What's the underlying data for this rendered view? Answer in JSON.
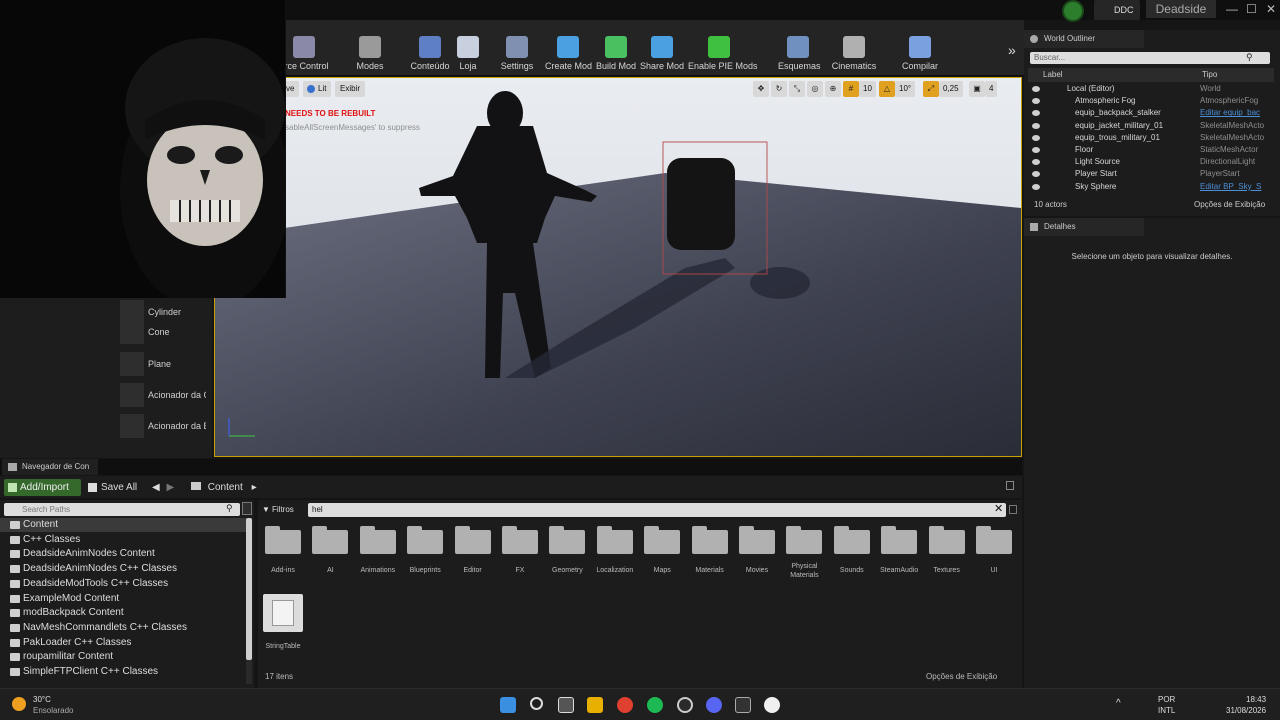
{
  "titlebar": {
    "ddc_label": "DDC",
    "project_tab": "Deadside",
    "minimize": "—",
    "maximize": "☐",
    "close": "✕"
  },
  "toolbar": {
    "buttons": [
      {
        "label": "urce Control",
        "icon": "source-control-icon",
        "color": "#8a8aa8"
      },
      {
        "label": "Modes",
        "icon": "modes-icon",
        "color": "#9a9a9a"
      },
      {
        "label": "Conteúdo",
        "icon": "content-icon",
        "color": "#5f7fc4"
      },
      {
        "label": "Loja",
        "icon": "store-icon",
        "color": "#c8d0e0"
      },
      {
        "label": "Settings",
        "icon": "settings-icon",
        "color": "#8090b0"
      },
      {
        "label": "Create Mod",
        "icon": "create-mod-icon",
        "color": "#4aa0e0"
      },
      {
        "label": "Build Mod",
        "icon": "build-mod-icon",
        "color": "#4ac060"
      },
      {
        "label": "Share Mod",
        "icon": "share-mod-icon",
        "color": "#4aa0e0"
      },
      {
        "label": "Enable PIE Mods",
        "icon": "enable-pie-icon",
        "color": "#40c040"
      },
      {
        "label": "Esquemas",
        "icon": "blueprints-icon",
        "color": "#7090c0"
      },
      {
        "label": "Cinematics",
        "icon": "cinematics-icon",
        "color": "#b0b0b0"
      },
      {
        "label": "Compilar",
        "icon": "compile-icon",
        "color": "#7aa0e0"
      }
    ],
    "overflow": "»"
  },
  "modes_panel": {
    "items": [
      "Cylinder",
      "Cone",
      "Plane",
      "Acionador da C",
      "Acionador da E"
    ]
  },
  "viewport": {
    "view_mode_left": "ve",
    "lit_label": "Lit",
    "show_label": "Exibir",
    "warning": "NEEDS TO BE REBUILT",
    "suppress_text": "sableAllScreenMessages' to suppress",
    "grid_snap": "10",
    "rotation_snap": "10°",
    "scale_snap": "0,25",
    "camera_speed": "4"
  },
  "world_outliner": {
    "tab_label": "World Outliner",
    "search_placeholder": "Buscar...",
    "col_label": "Label",
    "col_type": "Tipo",
    "rows": [
      {
        "name": "Local (Editor)",
        "type": "World",
        "link": false,
        "indent": 0
      },
      {
        "name": "Atmospheric Fog",
        "type": "AtmosphericFog",
        "link": false,
        "indent": 1
      },
      {
        "name": "equip_backpack_stalker",
        "type": "Editar equip_bac",
        "link": true,
        "indent": 1
      },
      {
        "name": "equip_jacket_military_01",
        "type": "SkeletalMeshActo",
        "link": false,
        "indent": 1
      },
      {
        "name": "equip_trous_military_01",
        "type": "SkeletalMeshActo",
        "link": false,
        "indent": 1
      },
      {
        "name": "Floor",
        "type": "StaticMeshActor",
        "link": false,
        "indent": 1
      },
      {
        "name": "Light Source",
        "type": "DirectionalLight",
        "link": false,
        "indent": 1
      },
      {
        "name": "Player Start",
        "type": "PlayerStart",
        "link": false,
        "indent": 1
      },
      {
        "name": "Sky Sphere",
        "type": "Editar BP_Sky_S",
        "link": true,
        "indent": 1
      }
    ],
    "actor_count": "10 actors",
    "view_options": "Opções de Exibição"
  },
  "details": {
    "tab_label": "Detalhes",
    "empty_message": "Selecione um objeto para visualizar detalhes."
  },
  "content_browser": {
    "tab_label": "Navegador de Con",
    "add_import": "Add/Import",
    "save_all": "Save All",
    "path_root": "Content",
    "paths_search_placeholder": "Search Paths",
    "paths": [
      {
        "name": "Content",
        "selected": true
      },
      {
        "name": "C++ Classes",
        "selected": false
      },
      {
        "name": "DeadsideAnimNodes Content",
        "selected": false
      },
      {
        "name": "DeadsideAnimNodes C++ Classes",
        "selected": false
      },
      {
        "name": "DeadsideModTools C++ Classes",
        "selected": false
      },
      {
        "name": "ExampleMod Content",
        "selected": false
      },
      {
        "name": "modBackpack Content",
        "selected": false
      },
      {
        "name": "NavMeshCommandlets C++ Classes",
        "selected": false
      },
      {
        "name": "PakLoader C++ Classes",
        "selected": false
      },
      {
        "name": "roupamilitar Content",
        "selected": false
      },
      {
        "name": "SimpleFTPClient C++ Classes",
        "selected": false
      }
    ],
    "filters_label": "Filtros",
    "search_value": "hel",
    "folders": [
      "Add-ins",
      "AI",
      "Animations",
      "Blueprints",
      "Editor",
      "FX",
      "Geometry",
      "Localization",
      "Maps",
      "Materials",
      "Movies",
      "Physical Materials",
      "Sounds",
      "SteamAudio",
      "Textures",
      "UI"
    ],
    "string_table_label": "StringTable",
    "item_count": "17 itens",
    "view_options": "Opções de Exibição"
  },
  "taskbar": {
    "weather_temp": "30°C",
    "weather_desc": "Ensolarado",
    "lang_top": "POR",
    "lang_bottom": "INTL",
    "time": "18:43",
    "date": "31/08/2026"
  }
}
